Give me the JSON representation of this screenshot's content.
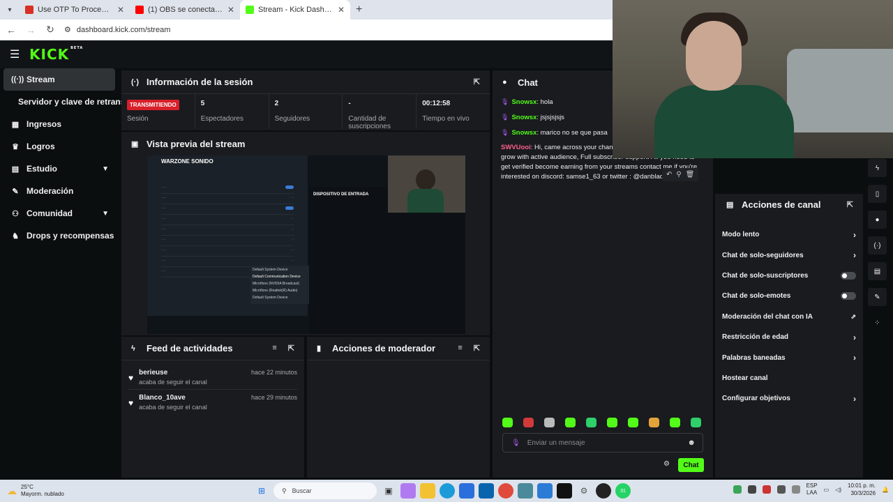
{
  "browser": {
    "tabs": [
      {
        "title": "Use OTP To Proceed - snowsx8",
        "color": "#d93025"
      },
      {
        "title": "(1) OBS se conecta y desconect",
        "color": "#ff0000"
      },
      {
        "title": "Stream - Kick Dashboard",
        "color": "#53fc18"
      }
    ],
    "url": "dashboard.kick.com/stream"
  },
  "brand": {
    "logo": "KICK",
    "beta": "BETA",
    "accent": "#53fc18"
  },
  "sidebar": {
    "items": [
      {
        "label": "Stream",
        "icon": "broadcast-icon"
      },
      {
        "label": "Servidor y clave de retransmisión"
      },
      {
        "label": "Ingresos",
        "icon": "chart-icon"
      },
      {
        "label": "Logros",
        "icon": "trophy-icon"
      },
      {
        "label": "Estudio",
        "icon": "studio-icon"
      },
      {
        "label": "Moderación",
        "icon": "wrench-icon"
      },
      {
        "label": "Comunidad",
        "icon": "users-icon"
      },
      {
        "label": "Drops y recompensas",
        "icon": "drops-icon"
      }
    ]
  },
  "session": {
    "title": "Información de la sesión",
    "status_badge": "TRANSMITIENDO",
    "stats": [
      {
        "label": "Sesión",
        "value": ""
      },
      {
        "label": "Espectadores",
        "value": "5"
      },
      {
        "label": "Seguidores",
        "value": "2"
      },
      {
        "label": "Cantidad de suscripciones",
        "value": "-"
      },
      {
        "label": "Tiempo en vivo",
        "value": "00:12:58"
      }
    ]
  },
  "preview": {
    "title": "Vista previa del stream",
    "game_label": "WARZONE SONIDO",
    "panel_title": "DISPOSITIVO DE ENTRADA",
    "popup_items": [
      "Default System Device",
      "Default Communication Device",
      "Micrófono (NVIDIA Broadcast)",
      "Micrófono (Realtek(R) Audio)",
      "Default System Device"
    ]
  },
  "feed": {
    "title": "Feed de actividades",
    "items": [
      {
        "name": "berieuse",
        "action": "acaba de seguir el canal",
        "time": "hace 22 minutos"
      },
      {
        "name": "Blanco_10ave",
        "action": "acaba de seguir el canal",
        "time": "hace 29 minutos"
      }
    ]
  },
  "mod_panel": {
    "title": "Acciones de moderador"
  },
  "chat": {
    "title": "Chat",
    "messages": [
      {
        "user": "Snowsx",
        "text": ": hola"
      },
      {
        "user": "Snowsx",
        "text": ": jsjsjsjsjs"
      },
      {
        "user": "Snowsx",
        "text": ": marico no se que pasa"
      },
      {
        "user": "SWVUooi",
        "text": ": Hi, came across your channel and I think I can help you grow with active audience, Full subscriber support. All you need to get verified become earning from your streams contact me if you're interested on discord: samse1_63 or twitter : @danblaqq"
      }
    ],
    "input_placeholder": "Enviar un mensaje",
    "send_label": "Chat"
  },
  "channel_actions": {
    "title": "Acciones de canal",
    "items": [
      {
        "label": "Modo lento",
        "control": "chevron"
      },
      {
        "label": "Chat de solo-seguidores",
        "control": "chevron"
      },
      {
        "label": "Chat de solo-suscriptores",
        "control": "toggle"
      },
      {
        "label": "Chat de solo-emotes",
        "control": "toggle"
      },
      {
        "label": "Moderación del chat con IA",
        "control": "external"
      },
      {
        "label": "Restricción de edad",
        "control": "chevron"
      },
      {
        "label": "Palabras baneadas",
        "control": "chevron"
      },
      {
        "label": "Hostear canal",
        "control": "none"
      },
      {
        "label": "Configurar objetivos",
        "control": "chevron"
      }
    ]
  },
  "taskbar": {
    "weather_temp": "25°C",
    "weather_desc": "Mayorm. nublado",
    "search_placeholder": "Buscar",
    "lang_top": "ESP",
    "lang_bottom": "LAA",
    "time": "10:01 p. m.",
    "date": "30/3/2026",
    "badge_count": "31"
  }
}
